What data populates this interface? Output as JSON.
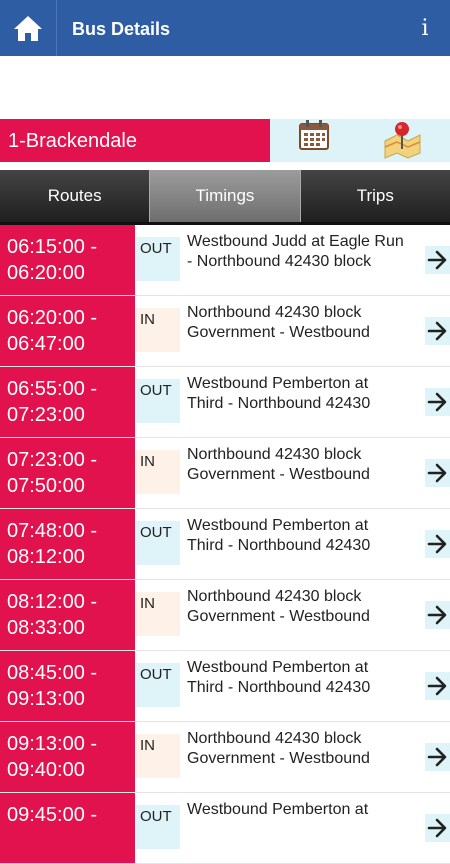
{
  "header": {
    "title": "Bus Details",
    "info_label": "i",
    "home_icon": "home-icon",
    "bg_color": "#2f5da4"
  },
  "route": {
    "name": "1-Brackendale",
    "calendar_icon": "calendar-icon",
    "map_icon": "map-pin-icon",
    "accent_color": "#e1124e"
  },
  "tabs": [
    {
      "label": "Routes",
      "active": false
    },
    {
      "label": "Timings",
      "active": true
    },
    {
      "label": "Trips",
      "active": false
    }
  ],
  "timings": [
    {
      "start": "06:15:00 -",
      "end": "06:20:00",
      "direction": "OUT",
      "line1": "Westbound Judd at Eagle Run",
      "line2": "- Northbound 42430 block"
    },
    {
      "start": "06:20:00 -",
      "end": "06:47:00",
      "direction": "IN",
      "line1": "Northbound 42430 block",
      "line2": "Government - Westbound"
    },
    {
      "start": "06:55:00 -",
      "end": "07:23:00",
      "direction": "OUT",
      "line1": "Westbound Pemberton at",
      "line2": "Third - Northbound 42430"
    },
    {
      "start": "07:23:00 -",
      "end": "07:50:00",
      "direction": "IN",
      "line1": "Northbound 42430 block",
      "line2": "Government - Westbound"
    },
    {
      "start": "07:48:00 -",
      "end": "08:12:00",
      "direction": "OUT",
      "line1": "Westbound Pemberton at",
      "line2": "Third - Northbound 42430"
    },
    {
      "start": "08:12:00 -",
      "end": "08:33:00",
      "direction": "IN",
      "line1": "Northbound 42430 block",
      "line2": "Government - Westbound"
    },
    {
      "start": "08:45:00 -",
      "end": "09:13:00",
      "direction": "OUT",
      "line1": "Westbound Pemberton at",
      "line2": "Third - Northbound 42430"
    },
    {
      "start": "09:13:00 -",
      "end": "09:40:00",
      "direction": "IN",
      "line1": "Northbound 42430 block",
      "line2": "Government - Westbound"
    },
    {
      "start": "09:45:00 -",
      "end": "",
      "direction": "OUT",
      "line1": "Westbound Pemberton at",
      "line2": ""
    }
  ]
}
